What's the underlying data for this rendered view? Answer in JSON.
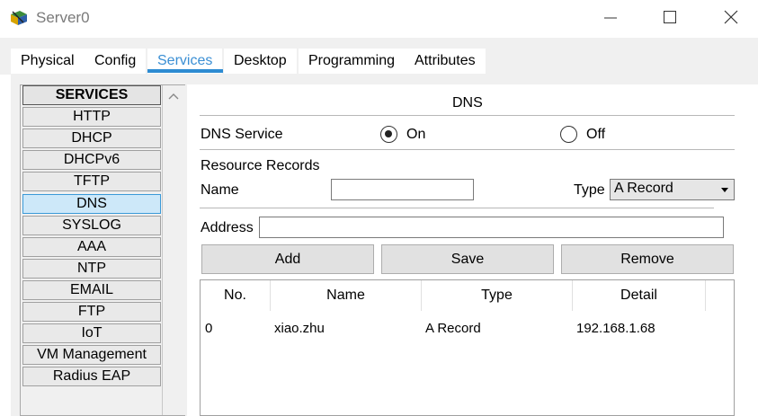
{
  "window": {
    "title": "Server0"
  },
  "tabs": [
    {
      "label": "Physical"
    },
    {
      "label": "Config"
    },
    {
      "label": "Services"
    },
    {
      "label": "Desktop"
    },
    {
      "label": "Programming"
    },
    {
      "label": "Attributes"
    }
  ],
  "sidebar": {
    "header": "SERVICES",
    "items": [
      "HTTP",
      "DHCP",
      "DHCPv6",
      "TFTP",
      "DNS",
      "SYSLOG",
      "AAA",
      "NTP",
      "EMAIL",
      "FTP",
      "IoT",
      "VM Management",
      "Radius EAP"
    ],
    "selected": "DNS"
  },
  "dns": {
    "title": "DNS",
    "service_label": "DNS Service",
    "on_label": "On",
    "off_label": "Off",
    "service_state": "On",
    "records_label": "Resource Records",
    "name_label": "Name",
    "name_value": "",
    "type_label": "Type",
    "type_value": "A Record",
    "address_label": "Address",
    "address_value": "",
    "add_label": "Add",
    "save_label": "Save",
    "remove_label": "Remove"
  },
  "table": {
    "headers": [
      "No.",
      "Name",
      "Type",
      "Detail"
    ],
    "rows": [
      {
        "no": "0",
        "name": "xiao.zhu",
        "type": "A Record",
        "detail": "192.168.1.68"
      }
    ]
  }
}
